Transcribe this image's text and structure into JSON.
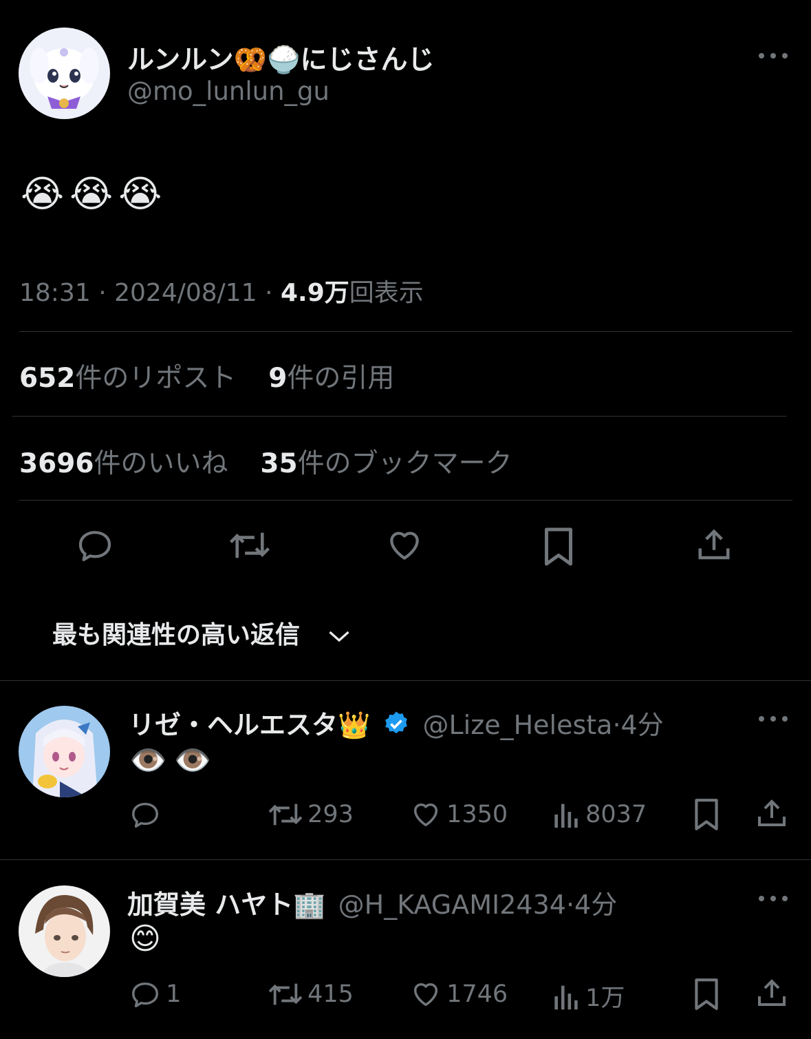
{
  "tweet": {
    "display_name": "ルンルン🥨🍚にじさんじ",
    "handle": "@mo_lunlun_gu",
    "body": "😭😭😭",
    "time": "18:31",
    "date": "2024/08/11",
    "views_num": "4.9万",
    "views_label": "回表示",
    "sep": "·",
    "reposts_num": "652",
    "reposts_label": "件のリポスト",
    "quotes_num": "9",
    "quotes_label": "件の引用",
    "likes_num": "3696",
    "likes_label": "件のいいね",
    "bookmarks_num": "35",
    "bookmarks_label": "件のブックマーク"
  },
  "sort": {
    "label": "最も関連性の高い返信"
  },
  "replies": [
    {
      "display_name": "リゼ・ヘルエスタ👑",
      "handle": "@Lize_Helesta",
      "time": "4分",
      "body": "👁️👁️",
      "reply_count": "",
      "repost_count": "293",
      "like_count": "1350",
      "view_count": "8037"
    },
    {
      "display_name": "加賀美 ハヤト🏢",
      "handle": "@H_KAGAMI2434",
      "time": "4分",
      "body": "😊",
      "reply_count": "1",
      "repost_count": "415",
      "like_count": "1746",
      "view_count": "1万"
    }
  ],
  "colors": {
    "background": "#000000",
    "text": "#e7e9ea",
    "secondary": "#71767b",
    "divider": "#2f3336",
    "verified": "#1d9bf0"
  },
  "icons": [
    "more-icon",
    "reply-icon",
    "repost-icon",
    "like-icon",
    "bookmark-icon",
    "share-icon",
    "chevron-down-icon",
    "views-icon",
    "verified-badge-icon"
  ]
}
